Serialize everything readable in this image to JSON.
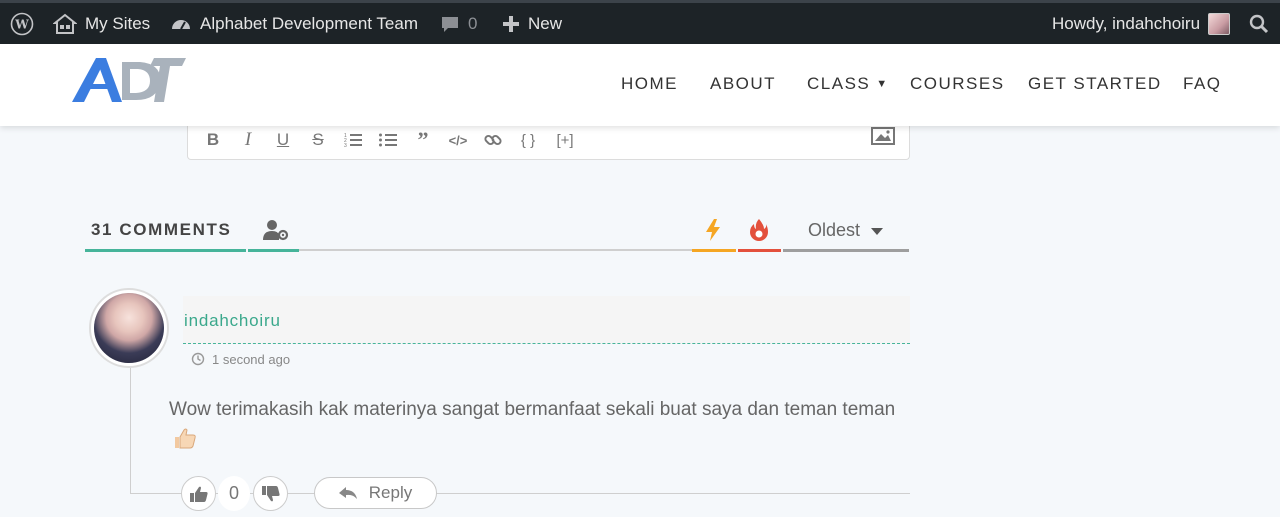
{
  "admin_bar": {
    "my_sites": "My Sites",
    "site_name": "Alphabet Development Team",
    "comment_count": "0",
    "new_label": "New",
    "howdy": "Howdy, indahchoiru"
  },
  "nav": {
    "items": [
      {
        "label": "HOME"
      },
      {
        "label": "ABOUT"
      },
      {
        "label": "CLASS"
      },
      {
        "label": "COURSES"
      },
      {
        "label": "GET STARTED"
      },
      {
        "label": "FAQ"
      }
    ]
  },
  "comments": {
    "count_label": "31 COMMENTS",
    "sort": "Oldest",
    "tab_colors": {
      "active": "#46b49a",
      "trending": "#f5a623",
      "hot": "#e3503c",
      "sort": "#9e9e9e"
    },
    "items": [
      {
        "author": "indahchoiru",
        "time": "1 second ago",
        "text": "Wow terimakasih kak materinya sangat bermanfaat sekali buat saya dan teman teman",
        "emoji": "thumbs-up",
        "votes": "0",
        "reply_label": "Reply"
      }
    ]
  }
}
